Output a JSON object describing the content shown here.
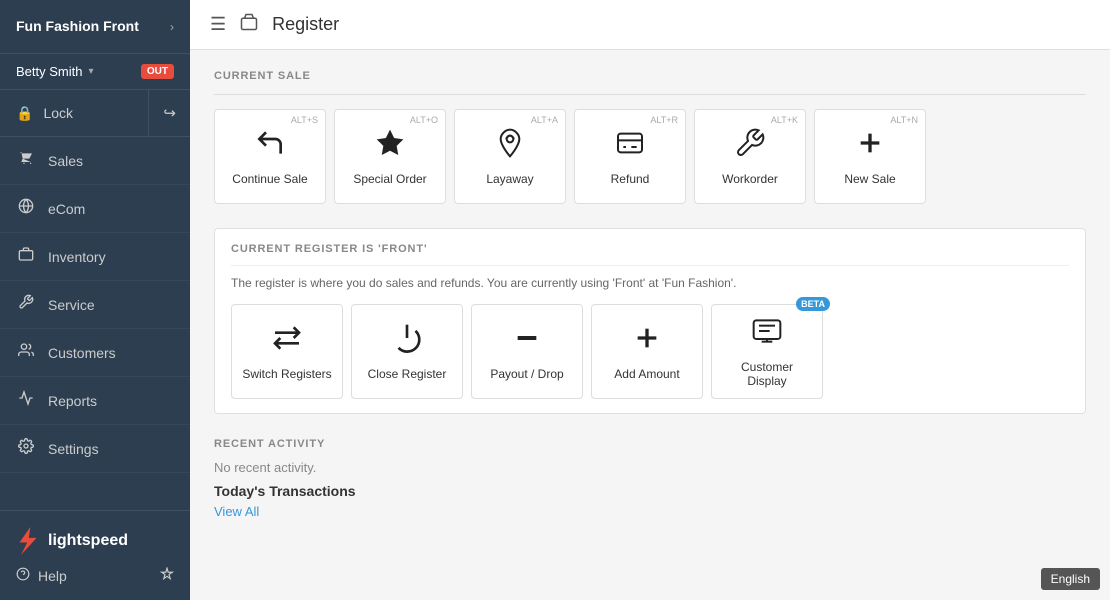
{
  "brand": {
    "name": "Fun Fashion Front",
    "chevron": "›"
  },
  "user": {
    "name": "Betty Smith",
    "status": "OUT"
  },
  "lock": {
    "label": "Lock"
  },
  "nav": {
    "items": [
      {
        "id": "sales",
        "label": "Sales",
        "icon": "💰"
      },
      {
        "id": "ecom",
        "label": "eCom",
        "icon": "🌐"
      },
      {
        "id": "inventory",
        "label": "Inventory",
        "icon": "📦"
      },
      {
        "id": "service",
        "label": "Service",
        "icon": "🔧"
      },
      {
        "id": "customers",
        "label": "Customers",
        "icon": "👥"
      },
      {
        "id": "reports",
        "label": "Reports",
        "icon": "📊"
      },
      {
        "id": "settings",
        "label": "Settings",
        "icon": "⚙️"
      }
    ]
  },
  "help": {
    "label": "Help"
  },
  "topbar": {
    "title": "Register"
  },
  "current_sale": {
    "section_label": "CURRENT SALE",
    "cards": [
      {
        "id": "continue-sale",
        "label": "Continue Sale",
        "shortcut": "ALT+S",
        "icon": "↩"
      },
      {
        "id": "special-order",
        "label": "Special Order",
        "shortcut": "ALT+O",
        "icon": "★"
      },
      {
        "id": "layaway",
        "label": "Layaway",
        "shortcut": "ALT+A",
        "icon": "☂"
      },
      {
        "id": "refund",
        "label": "Refund",
        "shortcut": "ALT+R",
        "icon": "🏷"
      },
      {
        "id": "workorder",
        "label": "Workorder",
        "shortcut": "ALT+K",
        "icon": "🔧"
      },
      {
        "id": "new-sale",
        "label": "New Sale",
        "shortcut": "ALT+N",
        "icon": "+"
      }
    ]
  },
  "current_register": {
    "section_label": "CURRENT REGISTER IS 'FRONT'",
    "desc": "The register is where you do sales and refunds. You are currently using 'Front'  at 'Fun Fashion'.",
    "cards": [
      {
        "id": "switch-registers",
        "label": "Switch Registers",
        "icon": "⇄",
        "beta": false
      },
      {
        "id": "close-register",
        "label": "Close Register",
        "icon": "⏻",
        "beta": false
      },
      {
        "id": "payout-drop",
        "label": "Payout / Drop",
        "icon": "−",
        "beta": false
      },
      {
        "id": "add-amount",
        "label": "Add Amount",
        "icon": "+",
        "beta": false
      },
      {
        "id": "customer-display",
        "label": "Customer Display",
        "icon": "☰",
        "beta": true
      }
    ]
  },
  "recent_activity": {
    "section_label": "RECENT ACTIVITY",
    "no_activity": "No recent activity.",
    "today_transactions": "Today's Transactions",
    "view_all": "View All"
  },
  "footer": {
    "english": "English"
  }
}
